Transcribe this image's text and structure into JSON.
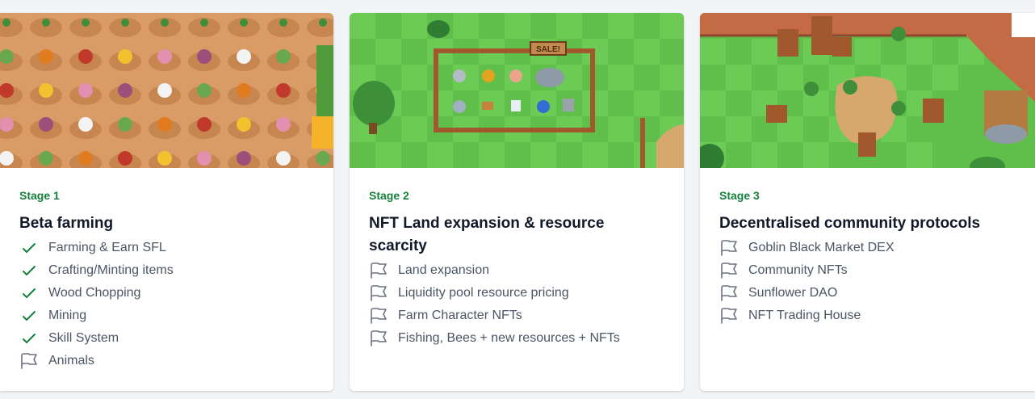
{
  "colors": {
    "accent_green": "#15803d",
    "title": "#111827",
    "text": "#4b5563",
    "icon_gray": "#6b7280"
  },
  "cards": [
    {
      "stage": "Stage 1",
      "title": "Beta farming",
      "items": [
        {
          "label": "Farming & Earn SFL",
          "icon": "check-icon"
        },
        {
          "label": "Crafting/Minting items",
          "icon": "check-icon"
        },
        {
          "label": "Wood Chopping",
          "icon": "check-icon"
        },
        {
          "label": "Mining",
          "icon": "check-icon"
        },
        {
          "label": "Skill System",
          "icon": "check-icon"
        },
        {
          "label": "Animals",
          "icon": "flag-icon"
        }
      ]
    },
    {
      "stage": "Stage 2",
      "title": "NFT Land expansion & resource scarcity",
      "image_sign": "SALE!",
      "items": [
        {
          "label": "Land expansion",
          "icon": "flag-icon"
        },
        {
          "label": "Liquidity pool resource pricing",
          "icon": "flag-icon"
        },
        {
          "label": "Farm Character NFTs",
          "icon": "flag-icon"
        },
        {
          "label": "Fishing, Bees + new resources + NFTs",
          "icon": "flag-icon"
        }
      ]
    },
    {
      "stage": "Stage 3",
      "title": "Decentralised community protocols",
      "items": [
        {
          "label": "Goblin Black Market DEX",
          "icon": "flag-icon"
        },
        {
          "label": "Community NFTs",
          "icon": "flag-icon"
        },
        {
          "label": "Sunflower DAO",
          "icon": "flag-icon"
        },
        {
          "label": "NFT Trading House",
          "icon": "flag-icon"
        }
      ]
    }
  ]
}
